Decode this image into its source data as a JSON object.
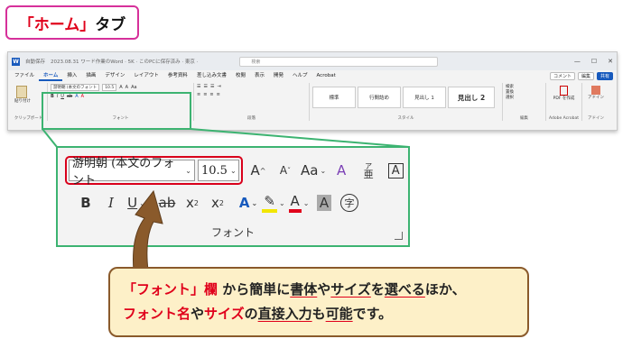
{
  "heading": {
    "part1": "「ホーム」",
    "part2": "タブ"
  },
  "titlebar": {
    "autosave": "自動保存",
    "doc": "2023.08.31  ワード作業のWord  · 5K  ·  このPCに保存済み  ·  東京  ·",
    "search": "検索",
    "win_min": "—",
    "win_max": "☐",
    "win_close": "✕"
  },
  "menubar": {
    "tabs": [
      "ファイル",
      "ホーム",
      "挿入",
      "描画",
      "デザイン",
      "レイアウト",
      "参考資料",
      "差し込み文書",
      "校閲",
      "表示",
      "開発",
      "ヘルプ",
      "Acrobat"
    ],
    "active_index": 1,
    "comment": "コメント",
    "edit": "編集",
    "share": "共有"
  },
  "ribbon_groups": {
    "clipboard": {
      "label": "クリップボード",
      "paste": "貼り付け"
    },
    "font": {
      "label": "フォント",
      "name": "游明朝 (本文のフォント",
      "size": "10.5"
    },
    "paragraph": {
      "label": "段落"
    },
    "styles": {
      "label": "スタイル",
      "items": [
        "標準",
        "行間詰め",
        "見出し 1",
        "見出し 2"
      ]
    },
    "editing": {
      "label": "編集",
      "find": "検索",
      "replace": "置換",
      "select": "選択"
    },
    "acrobat": {
      "label": "Adobe Acrobat",
      "pdf": "PDF を作成"
    },
    "addin": {
      "label": "アドイン",
      "btn": "アドイン"
    }
  },
  "zoom": {
    "font_name": "游明朝 (本文のフォント",
    "font_size": "10.5",
    "grow": "A",
    "shrink": "A",
    "case": "Aa",
    "clear": "A",
    "phonetic_top": "ア",
    "phonetic_bottom": "亜",
    "border_char": "A",
    "bold": "B",
    "italic": "I",
    "underline": "U",
    "strike": "ab",
    "sub": "x",
    "sup": "x",
    "effects": "A",
    "highlight": "✎",
    "color": "A",
    "shade": "A",
    "enclose": "字",
    "label": "フォント"
  },
  "callout": {
    "l1_a": "「フォント」欄",
    "l1_b": " から簡単に",
    "l1_c": "書体",
    "l1_d": "や",
    "l1_e": "サイズ",
    "l1_f": "を",
    "l1_g": "選べる",
    "l1_h": "ほか、",
    "l2_a": "フォント名",
    "l2_b": "や",
    "l2_c": "サイズ",
    "l2_d": "の",
    "l2_e": "直接入力",
    "l2_f": "も",
    "l2_g": "可能",
    "l2_h": "です。"
  },
  "colors": {
    "accent_red": "#e0001b",
    "green": "#3cb371",
    "brown": "#8a5a2b",
    "callout_bg": "#fdf0c8",
    "pink": "#d6309a"
  }
}
